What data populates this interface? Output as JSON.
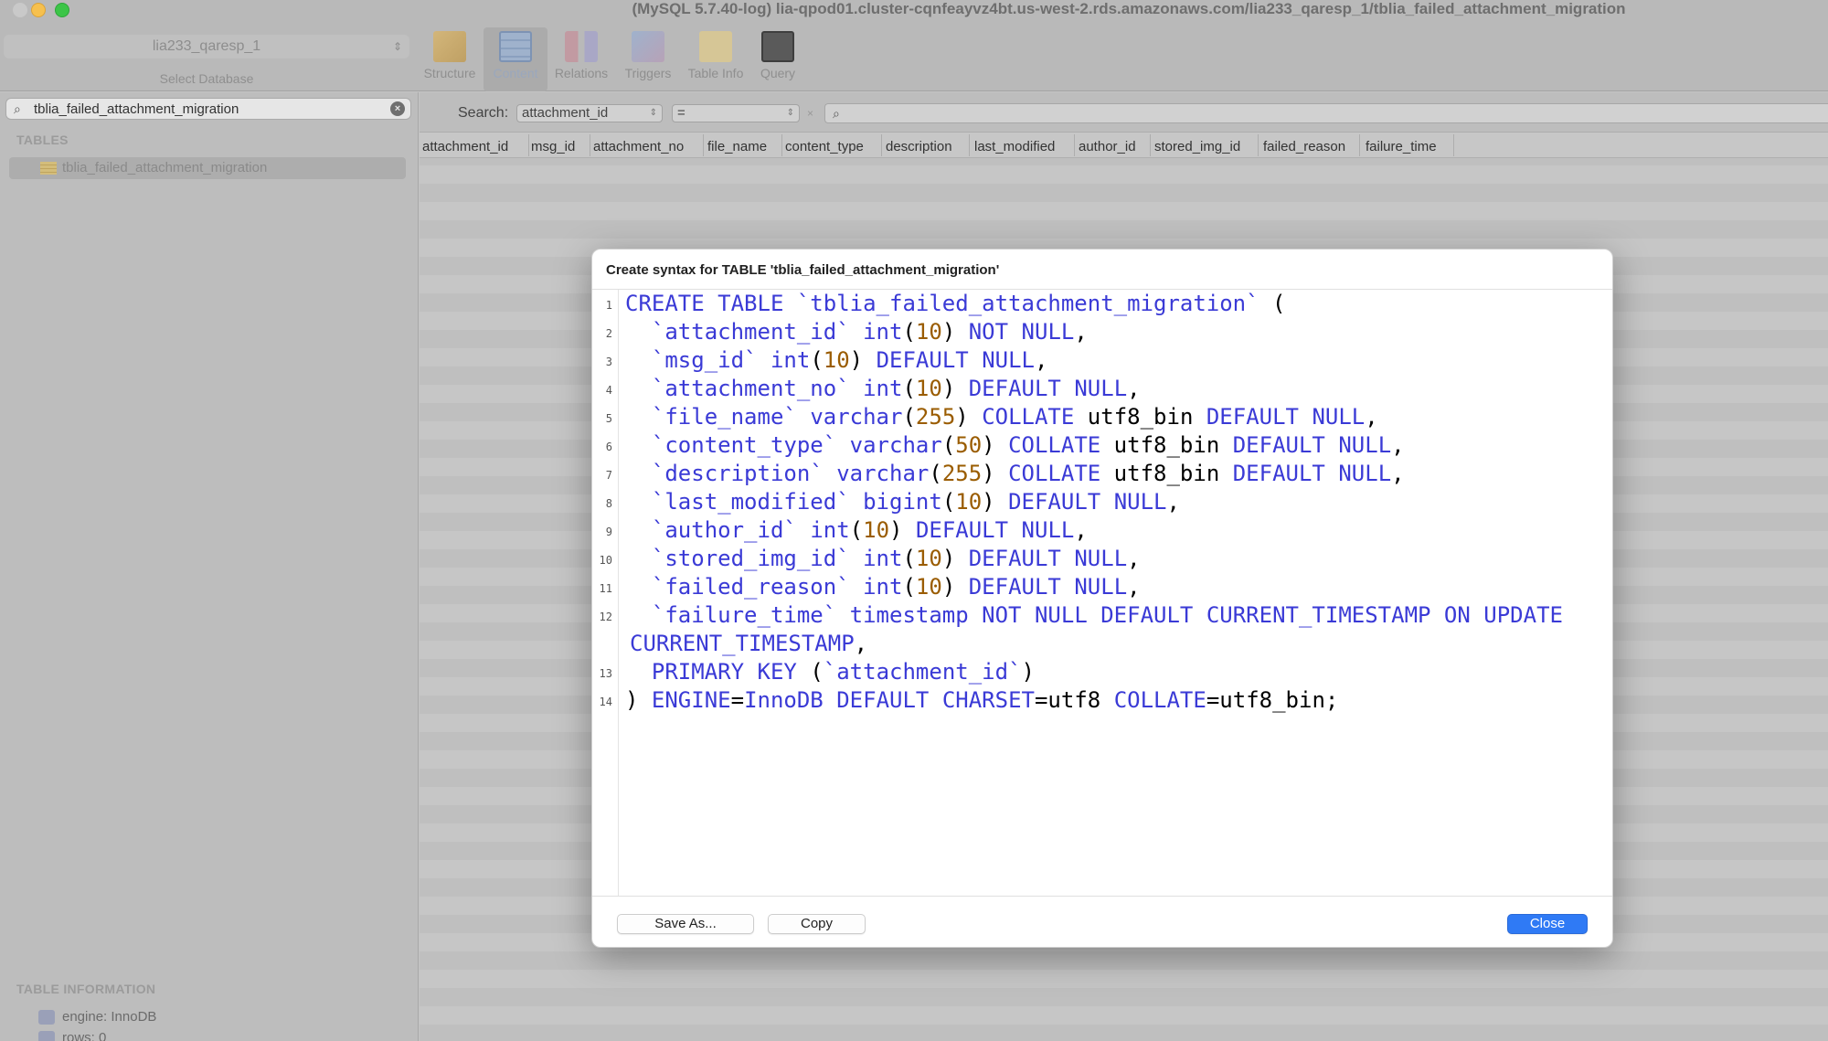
{
  "window": {
    "title": "(MySQL 5.7.40-log) lia-qpod01.cluster-cqnfeayvz4bt.us-west-2.rds.amazonaws.com/lia233_qaresp_1/tblia_failed_attachment_migration"
  },
  "toolbar": {
    "database_value": "lia233_qaresp_1",
    "database_caption": "Select Database",
    "tools": [
      {
        "label": "Structure",
        "icon": "structure-icon"
      },
      {
        "label": "Content",
        "icon": "content-icon",
        "active": true
      },
      {
        "label": "Relations",
        "icon": "relations-icon"
      },
      {
        "label": "Triggers",
        "icon": "triggers-icon"
      },
      {
        "label": "Table Info",
        "icon": "table-info-icon"
      },
      {
        "label": "Query",
        "icon": "query-icon"
      }
    ]
  },
  "sidebar": {
    "filter_value": "tblia_failed_attachment_migration",
    "tables_heading": "TABLES",
    "tables": [
      {
        "name": "tblia_failed_attachment_migration"
      }
    ],
    "info_heading": "TABLE INFORMATION",
    "info": [
      "engine: InnoDB",
      "rows: 0"
    ]
  },
  "content": {
    "search_label": "Search:",
    "search_field": "attachment_id",
    "search_operator": "=",
    "columns": [
      "attachment_id",
      "msg_id",
      "attachment_no",
      "file_name",
      "content_type",
      "description",
      "last_modified",
      "author_id",
      "stored_img_id",
      "failed_reason",
      "failure_time"
    ]
  },
  "modal": {
    "title": "Create syntax for TABLE 'tblia_failed_attachment_migration'",
    "line_numbers": [
      "1",
      "2",
      "3",
      "4",
      "5",
      "6",
      "7",
      "8",
      "9",
      "10",
      "11",
      "12",
      "13",
      "14"
    ],
    "code_lines": [
      "CREATE TABLE `tblia_failed_attachment_migration` (",
      "  `attachment_id` int(10) NOT NULL,",
      "  `msg_id` int(10) DEFAULT NULL,",
      "  `attachment_no` int(10) DEFAULT NULL,",
      "  `file_name` varchar(255) COLLATE utf8_bin DEFAULT NULL,",
      "  `content_type` varchar(50) COLLATE utf8_bin DEFAULT NULL,",
      "  `description` varchar(255) COLLATE utf8_bin DEFAULT NULL,",
      "  `last_modified` bigint(10) DEFAULT NULL,",
      "  `author_id` int(10) DEFAULT NULL,",
      "  `stored_img_id` int(10) DEFAULT NULL,",
      "  `failed_reason` int(10) DEFAULT NULL,",
      "  `failure_time` timestamp NOT NULL DEFAULT CURRENT_TIMESTAMP ON UPDATE",
      "CURRENT_TIMESTAMP,",
      "  PRIMARY KEY (`attachment_id`)",
      ") ENGINE=InnoDB DEFAULT CHARSET=utf8 COLLATE=utf8_bin;"
    ],
    "save_label": "Save As...",
    "copy_label": "Copy",
    "close_label": "Close"
  },
  "colors": {
    "keyword": "#3a3ad6",
    "number": "#9a5c00",
    "primary_button": "#2f7af5"
  }
}
